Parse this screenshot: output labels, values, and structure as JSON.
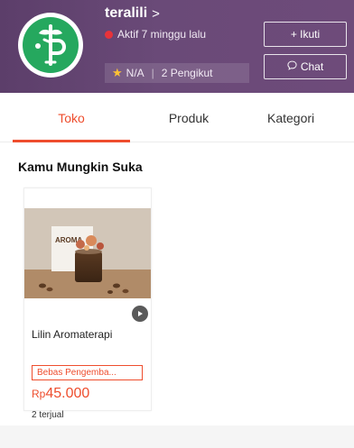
{
  "shop": {
    "name": "teralili",
    "chevron": ">",
    "status": "Aktif 7 minggu lalu",
    "rating": "N/A",
    "separator": "|",
    "followers": "2 Pengikut",
    "avatar_icon": "shop-logo-icon",
    "status_color": "#e8333a"
  },
  "actions": {
    "follow_label": "+ Ikuti",
    "chat_label": "Chat",
    "chat_icon": "chat-bubble-icon"
  },
  "tabs": [
    {
      "label": "Toko",
      "active": true
    },
    {
      "label": "Produk",
      "active": false
    },
    {
      "label": "Kategori",
      "active": false
    }
  ],
  "section": {
    "title": "Kamu Mungkin Suka"
  },
  "products": [
    {
      "name": "Lilin Aromaterapi",
      "badge": "Bebas Pengemba...",
      "currency": "Rp",
      "price": "45.000",
      "sold": "2 terjual",
      "has_video": true,
      "image_text": "AROMA"
    }
  ],
  "colors": {
    "accent": "#ee4d2d",
    "header_bg": "#6a4a78",
    "avatar_bg": "#25a85e",
    "star": "#ffc234"
  }
}
